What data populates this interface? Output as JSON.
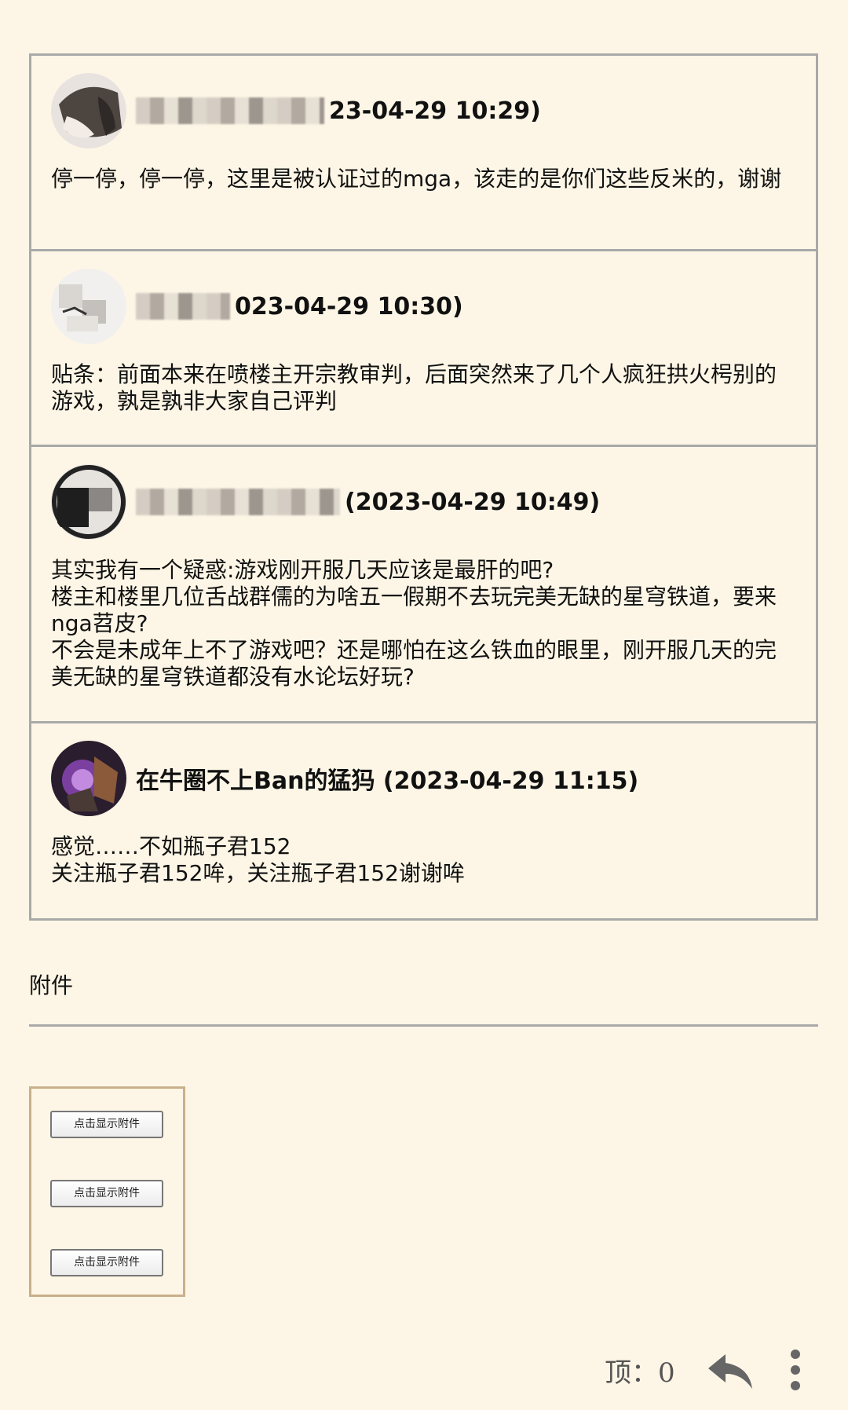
{
  "comments": [
    {
      "meta": "23-04-29 10:29)",
      "body": "停一停，停一停，这里是被认证过的mga，该走的是你们这些反米的，谢谢"
    },
    {
      "meta": "023-04-29 10:30)",
      "body": "贴条：前面本来在喷楼主开宗教审判，后面突然来了几个人疯狂拱火枵别的游戏，孰是孰非大家自己评判"
    },
    {
      "meta": "(2023-04-29 10:49)",
      "body": "其实我有一个疑惑:游戏刚开服几天应该是最肝的吧?\n楼主和楼里几位舌战群儒的为啥五一假期不去玩完美无缺的星穹铁道，要来nga苕皮?\n不会是未成年上不了游戏吧？还是哪怕在这么铁血的眼里，刚开服几天的完美无缺的星穹铁道都没有水论坛好玩?"
    },
    {
      "meta": "在牛圈不上Ban的猛犸 (2023-04-29 11:15)",
      "body": "感觉……不如瓶子君152\n关注瓶子君152哞，关注瓶子君152谢谢哞"
    }
  ],
  "attachments": {
    "title": "附件",
    "buttons": [
      "点击显示附件",
      "点击显示附件",
      "点击显示附件"
    ]
  },
  "bottom_bar": {
    "top_label": "顶：0",
    "reply_icon": "reply-icon",
    "more_icon": "more-vertical-icon"
  }
}
